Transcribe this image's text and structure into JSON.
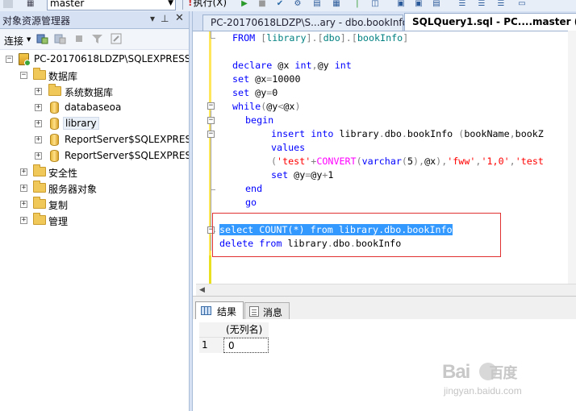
{
  "toolbar": {
    "database": "master",
    "execute_label": "执行(X)",
    "execute_glyph": "!"
  },
  "object_explorer": {
    "title": "对象资源管理器",
    "connect_label": "连接",
    "tree": {
      "server": "PC-20170618LDZP\\SQLEXPRESS",
      "databases_folder": "数据库",
      "databases": [
        "系统数据库",
        "databaseoa",
        "library",
        "ReportServer$SQLEXPRES",
        "ReportServer$SQLEXPRES"
      ],
      "folders": [
        "安全性",
        "服务器对象",
        "复制",
        "管理"
      ]
    }
  },
  "tabs": {
    "tab1_label": "PC-20170618LDZP\\S...ary - dbo.bookInfo",
    "tab2_label": "SQLQuery1.sql - PC....master (fww"
  },
  "editor": {
    "line1": "FROM [library].[dbo].[bookInfo]",
    "line2": "declare @x int,@y int",
    "line3": "set @x=10000",
    "line4": "set @y=0",
    "line5": "while(@y<@x)",
    "line6": "begin",
    "line7": "insert into library.dbo.bookInfo (bookName,bookZ",
    "line8": "values",
    "line9": "('test'+CONVERT(varchar(5),@x),'fww','1,0','test",
    "line10": "set @y=@y+1",
    "line11": "end",
    "line12": "go",
    "line13": "select COUNT(*) from library.dbo.bookInfo",
    "line14": "delete from library.dbo.bookInfo"
  },
  "results": {
    "tab_results": "结果",
    "tab_messages": "消息",
    "column_header": "(无列名)",
    "row_number": "1",
    "value": "0"
  },
  "watermark": {
    "logo": "Bai",
    "logo_end": "百度",
    "sub": "jingyan.baidu.com"
  },
  "colors": {
    "keyword": "#0000ff",
    "function": "#ff00ff",
    "string": "#ff0000",
    "selection": "#3399ff",
    "highlight_box": "#e03030"
  }
}
